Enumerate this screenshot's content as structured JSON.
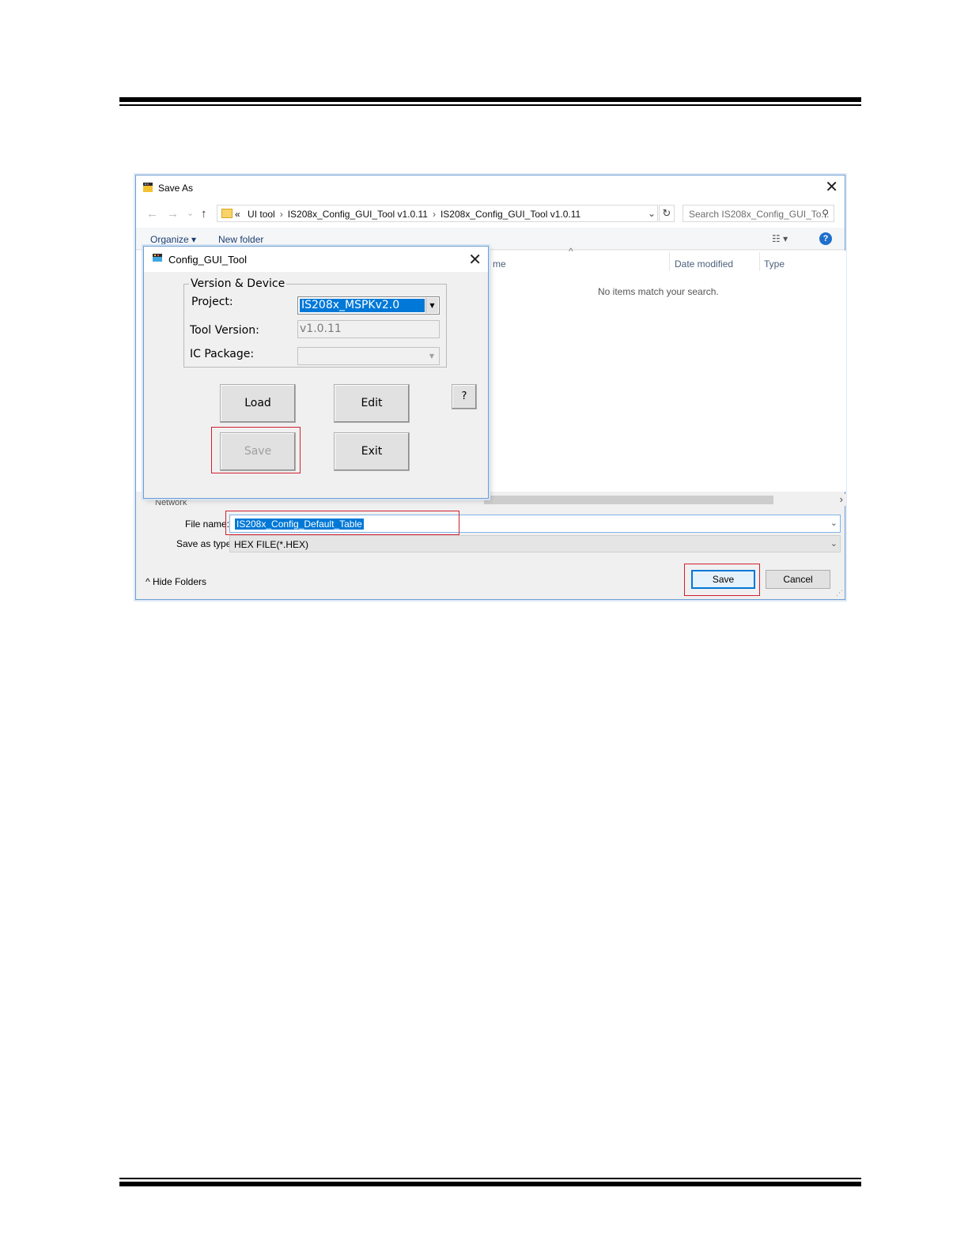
{
  "save_as": {
    "title": "Save As",
    "close_glyph": "✕",
    "nav": {
      "back": "←",
      "forward": "→",
      "recent": "⌄",
      "up": "↑"
    },
    "address": {
      "prefix": "«",
      "segments": [
        "UI tool",
        "IS208x_Config_GUI_Tool v1.0.11",
        "IS208x_Config_GUI_Tool v1.0.11"
      ],
      "dropdown_glyph": "⌄"
    },
    "refresh_glyph": "↻",
    "search": {
      "placeholder": "Search IS208x_Config_GUI_To...",
      "icon": "⚲"
    },
    "toolbar": {
      "organize": "Organize ▾",
      "new_folder": "New folder",
      "view_glyph": "☷ ▾",
      "help_glyph": "?"
    },
    "columns": {
      "name_partial": "me",
      "date_modified": "Date modified",
      "type": "Type",
      "sort_glyph": "^"
    },
    "empty_message": "No items match your search.",
    "scroll_right_glyph": "›",
    "file_name": {
      "label": "File name:",
      "value": "IS208x_Config_Default_Table",
      "chev": "⌄"
    },
    "save_type": {
      "label": "Save as type:",
      "value": "HEX FILE(*.HEX)",
      "chev": "⌄"
    },
    "hide_folders": "^  Hide Folders",
    "buttons": {
      "save": "Save",
      "cancel": "Cancel"
    },
    "network_partial": "Network",
    "accent_color": "#0078d7",
    "highlight_color": "#d21f2f"
  },
  "config_tool": {
    "title": "Config_GUI_Tool",
    "close_glyph": "✕",
    "group_title": "Version & Device",
    "project": {
      "label": "Project:",
      "value": "IS208x_MSPKv2.0",
      "arrow": "▼"
    },
    "tool_version": {
      "label": "Tool Version:",
      "value": "v1.0.11"
    },
    "ic_package": {
      "label": "IC Package:",
      "value": "",
      "arrow": "▼"
    },
    "buttons": {
      "load": "Load",
      "edit": "Edit",
      "save": "Save",
      "exit": "Exit",
      "help": "?"
    }
  }
}
